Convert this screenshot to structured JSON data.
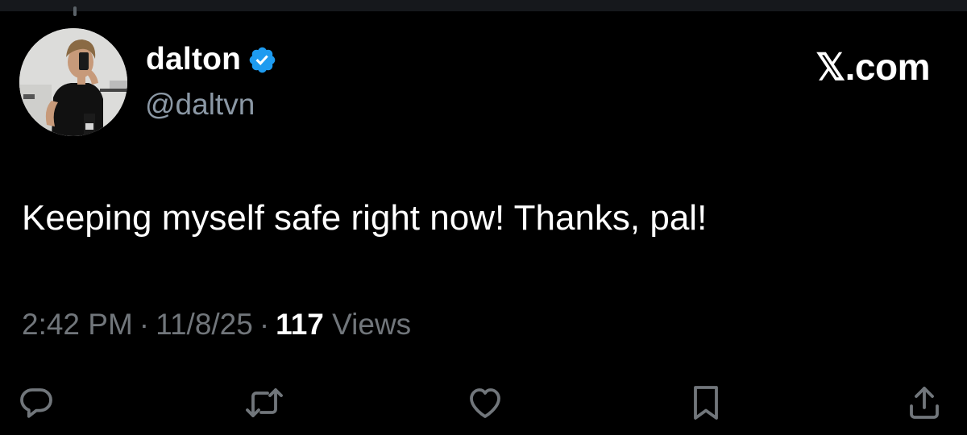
{
  "tweet": {
    "display_name": "dalton",
    "handle": "@daltvn",
    "verified": true,
    "text": "Keeping myself safe right now! Thanks, pal!",
    "time": "2:42 PM",
    "date": "11/8/25",
    "separator": "·",
    "views_count": "117",
    "views_label": "Views"
  },
  "brand": {
    "label": "𝕏.com"
  },
  "icons": {
    "avatar": "profile-photo",
    "verified": "verified-badge-icon",
    "reply": "reply-icon",
    "repost": "repost-icon",
    "like": "heart-icon",
    "bookmark": "bookmark-icon",
    "share": "share-icon"
  },
  "colors": {
    "background": "#000000",
    "text_primary": "#ffffff",
    "text_secondary": "#71767b",
    "verified_blue": "#1d9bf0",
    "icon_gray": "#71767b"
  }
}
